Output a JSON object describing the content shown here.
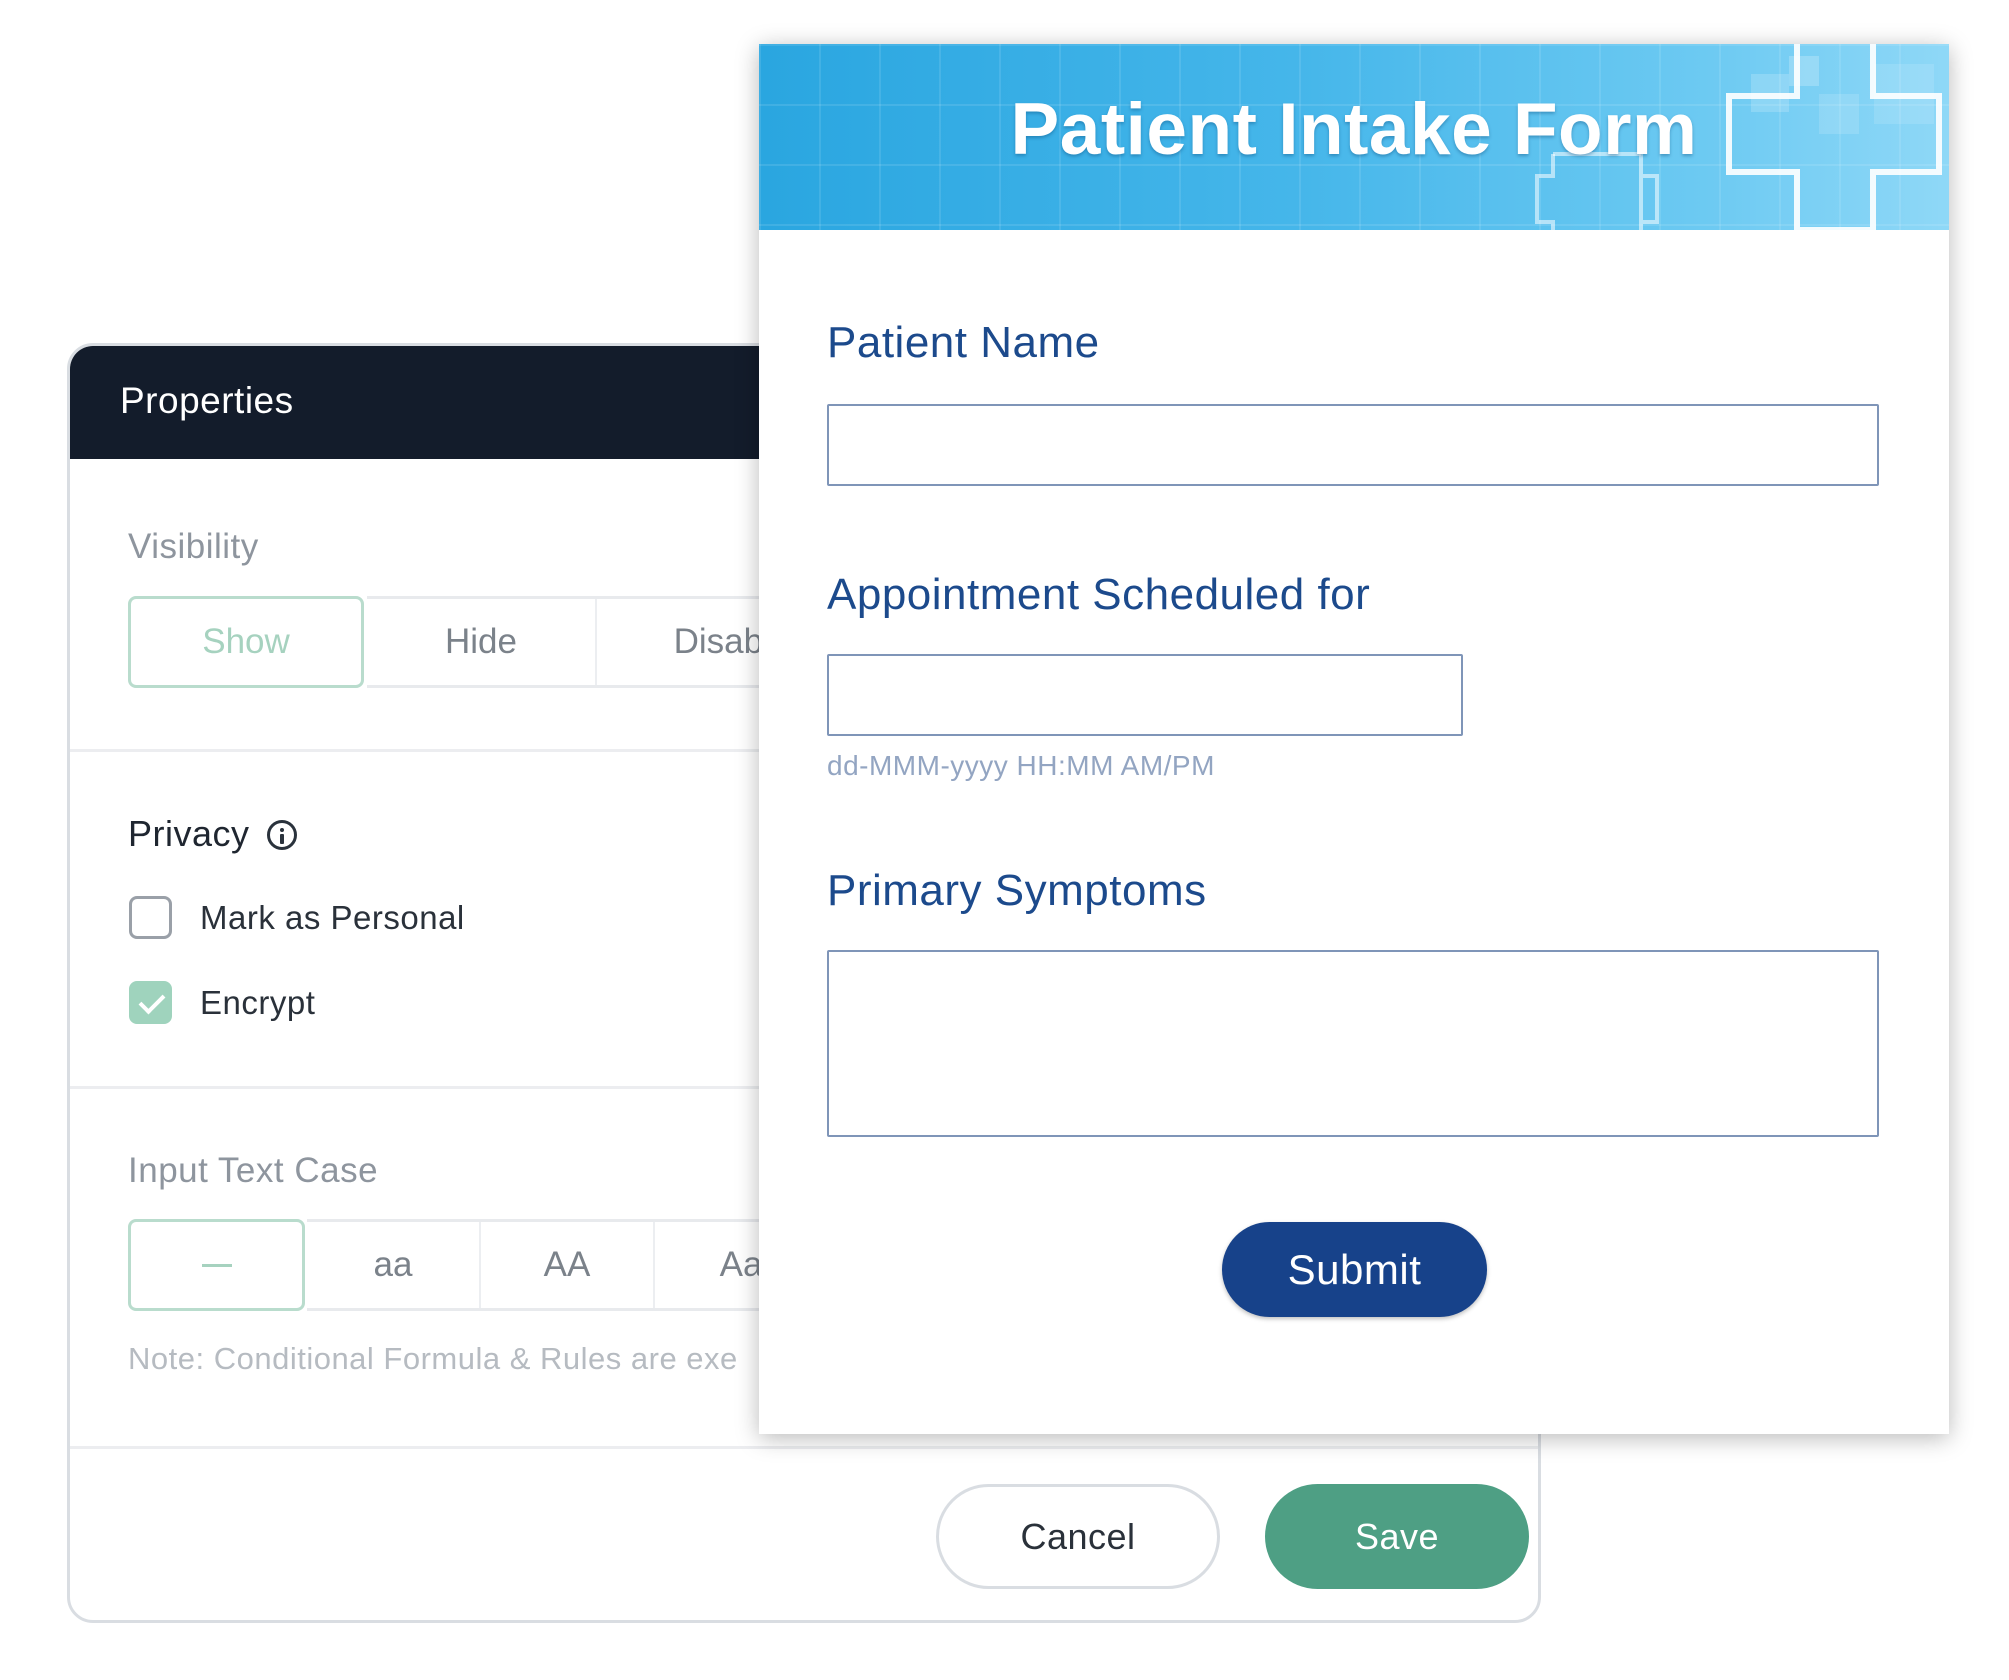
{
  "properties": {
    "title": "Properties",
    "visibility": {
      "label": "Visibility",
      "options": [
        "Show",
        "Hide",
        "Disable"
      ],
      "selected": "Show"
    },
    "privacy": {
      "label": "Privacy",
      "info_icon": "info-icon",
      "options": [
        {
          "label": "Mark as Personal",
          "checked": false
        },
        {
          "label": "Encrypt",
          "checked": true
        }
      ]
    },
    "input_text_case": {
      "label": "Input Text Case",
      "options": [
        "—",
        "aa",
        "AA",
        "Aa"
      ],
      "selected": "—"
    },
    "note": "Note: Conditional Formula & Rules are exe",
    "cancel_label": "Cancel",
    "save_label": "Save"
  },
  "form": {
    "title": "Patient Intake Form",
    "fields": [
      {
        "label": "Patient Name",
        "value": ""
      },
      {
        "label": "Appointment Scheduled for",
        "value": "",
        "hint": "dd-MMM-yyyy HH:MM AM/PM"
      },
      {
        "label": "Primary Symptoms",
        "value": ""
      }
    ],
    "submit_label": "Submit"
  },
  "colors": {
    "panel_header": "#131c2b",
    "accent_green": "#4e9f84",
    "form_blue": "#1c4a8c",
    "submit_blue": "#17428a",
    "banner_blue": "#2aa6e0"
  }
}
